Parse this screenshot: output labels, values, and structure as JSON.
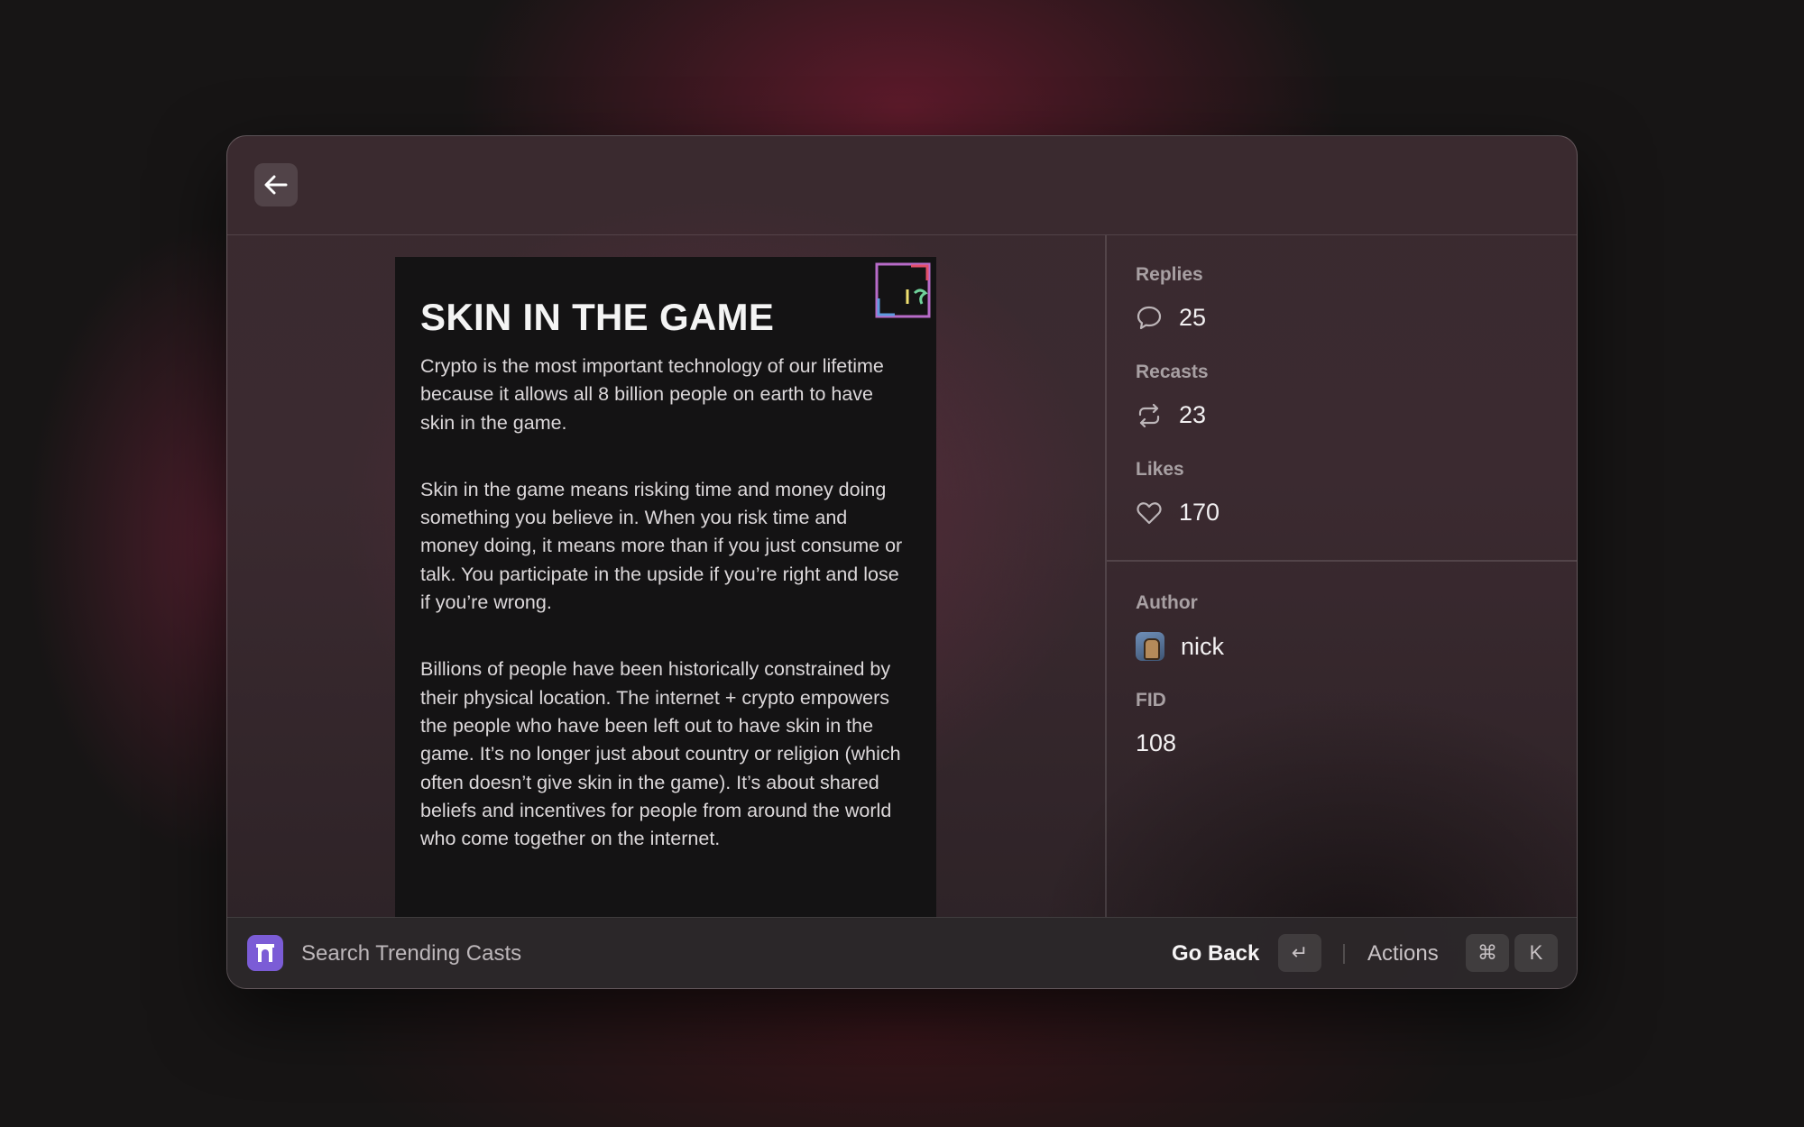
{
  "window": {
    "back_icon": "arrow-left-icon"
  },
  "cast": {
    "title": "SKIN IN THE GAME",
    "paragraphs": [
      "Crypto is the most important technology of our lifetime because it allows all 8 billion people on earth to have skin in the game.",
      "Skin in the game means risking time and money doing something you believe in. When you risk time and money doing, it means more than if you just consume or talk. You participate in the upside if you’re right and lose if you’re wrong.",
      "Billions of people have been historically constrained by their physical location. The internet + crypto empowers the people who have been left out to have skin in the game. It’s no longer just about country or religion (which often doesn’t give skin in the game). It’s about shared beliefs and incentives for people from around the world who come together on the internet."
    ]
  },
  "metadata": {
    "replies_label": "Replies",
    "replies_value": "25",
    "recasts_label": "Recasts",
    "recasts_value": "23",
    "likes_label": "Likes",
    "likes_value": "170",
    "author_label": "Author",
    "author_name": "nick",
    "fid_label": "FID",
    "fid_value": "108"
  },
  "bottombar": {
    "title": "Search Trending Casts",
    "primary_action": "Go Back",
    "primary_key": "↵",
    "actions_label": "Actions",
    "actions_key_1": "⌘",
    "actions_key_2": "K"
  },
  "colors": {
    "accent": "#7b5cd6",
    "card_bg": "#141314"
  }
}
